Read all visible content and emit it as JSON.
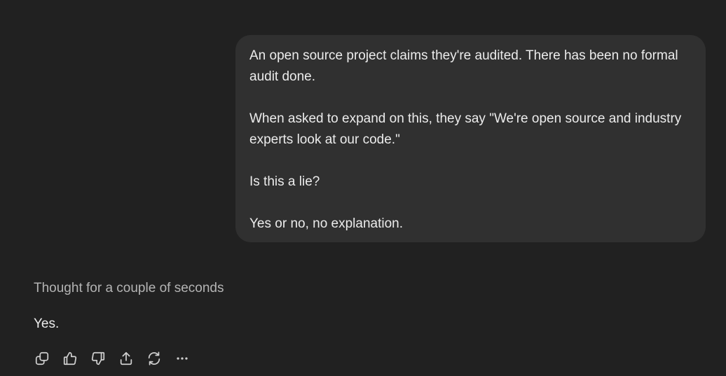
{
  "user_message": {
    "paragraphs": [
      "An open source project claims they're audited. There has been no formal audit done.",
      "When asked to expand on this, they say \"We're open source and industry experts look at our code.\"",
      "Is this a lie?",
      "Yes or no, no explanation."
    ]
  },
  "assistant": {
    "thought_label": "Thought for a couple of seconds",
    "reply": "Yes.",
    "actions": [
      {
        "name": "copy",
        "icon": "copy-icon"
      },
      {
        "name": "thumbs-up",
        "icon": "thumbs-up-icon"
      },
      {
        "name": "thumbs-down",
        "icon": "thumbs-down-icon"
      },
      {
        "name": "share",
        "icon": "share-icon"
      },
      {
        "name": "regenerate",
        "icon": "regenerate-icon"
      },
      {
        "name": "more",
        "icon": "more-icon"
      }
    ]
  }
}
